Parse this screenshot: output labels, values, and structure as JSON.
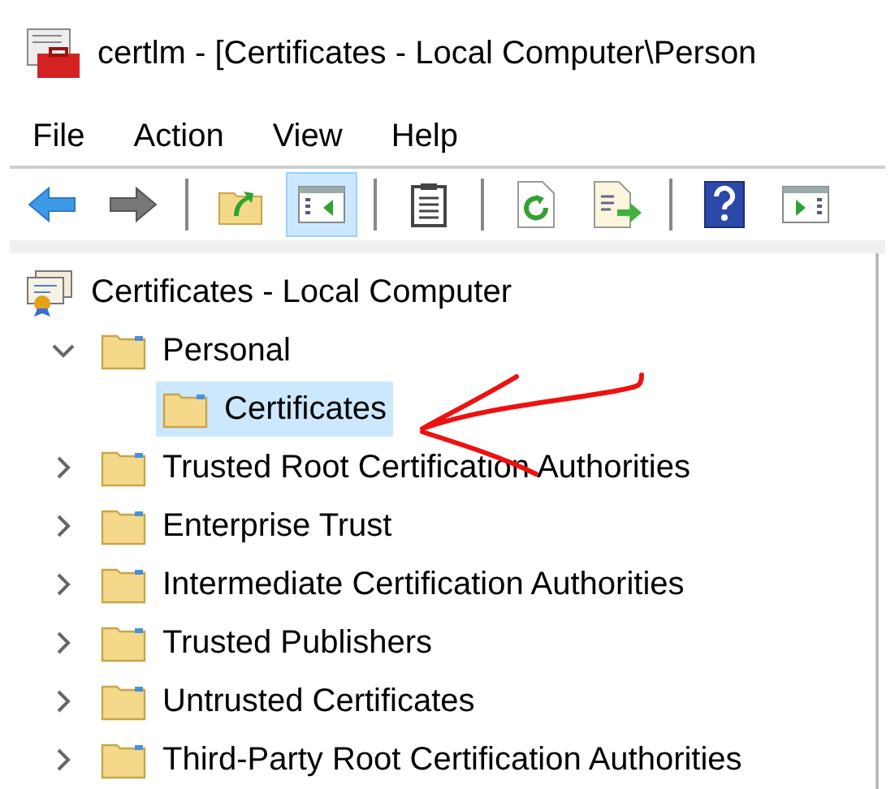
{
  "window": {
    "title": "certlm - [Certificates - Local Computer\\Person"
  },
  "menu": [
    "File",
    "Action",
    "View",
    "Help"
  ],
  "toolbar": [
    {
      "kind": "back",
      "pressed": false
    },
    {
      "kind": "forward",
      "pressed": false
    },
    {
      "kind": "separator"
    },
    {
      "kind": "up",
      "pressed": false
    },
    {
      "kind": "tree",
      "pressed": true
    },
    {
      "kind": "separator"
    },
    {
      "kind": "clipboard",
      "pressed": false
    },
    {
      "kind": "separator"
    },
    {
      "kind": "refresh",
      "pressed": false
    },
    {
      "kind": "export",
      "pressed": false
    },
    {
      "kind": "separator"
    },
    {
      "kind": "help",
      "pressed": false
    },
    {
      "kind": "actionpane",
      "pressed": false
    }
  ],
  "tree": {
    "label": "Certificates - Local Computer",
    "children": [
      {
        "label": "Personal",
        "expanded": true,
        "selected": false,
        "children": [
          {
            "label": "Certificates",
            "selected": true
          }
        ]
      },
      {
        "label": "Trusted Root Certification Authorities",
        "expanded": false,
        "selected": false
      },
      {
        "label": "Enterprise Trust",
        "expanded": false,
        "selected": false
      },
      {
        "label": "Intermediate Certification Authorities",
        "expanded": false,
        "selected": false
      },
      {
        "label": "Trusted Publishers",
        "expanded": false,
        "selected": false
      },
      {
        "label": "Untrusted Certificates",
        "expanded": false,
        "selected": false
      },
      {
        "label": "Third-Party Root Certification Authorities",
        "expanded": false,
        "selected": false
      }
    ]
  }
}
